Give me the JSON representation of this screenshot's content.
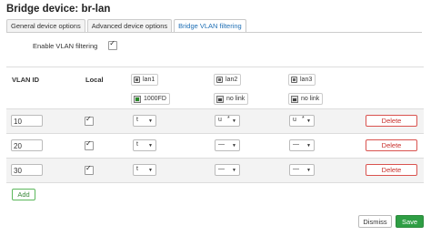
{
  "title": "Bridge device: br-lan",
  "tabs": [
    {
      "label": "General device options",
      "active": false
    },
    {
      "label": "Advanced device options",
      "active": false
    },
    {
      "label": "Bridge VLAN filtering",
      "active": true
    }
  ],
  "vlan_filtering": {
    "label": "Enable VLAN filtering",
    "checked": true
  },
  "table": {
    "headers": {
      "vlan_id": "VLAN ID",
      "local": "Local"
    },
    "ports": [
      {
        "name": "lan1",
        "status": "1000FD",
        "status_icon": "link-up-icon"
      },
      {
        "name": "lan2",
        "status": "no link",
        "status_icon": "no-link-icon"
      },
      {
        "name": "lan3",
        "status": "no link",
        "status_icon": "no-link-icon"
      }
    ],
    "rows": [
      {
        "vlan_id": "10",
        "local": true,
        "lan1": "t",
        "lan2": "u",
        "lan2_flag": "*",
        "lan3": "u",
        "lan3_flag": "*"
      },
      {
        "vlan_id": "20",
        "local": true,
        "lan1": "t",
        "lan2": "—",
        "lan2_flag": "",
        "lan3": "—",
        "lan3_flag": ""
      },
      {
        "vlan_id": "30",
        "local": true,
        "lan1": "t",
        "lan2": "—",
        "lan2_flag": "",
        "lan3": "—",
        "lan3_flag": ""
      }
    ],
    "delete_label": "Delete"
  },
  "add_label": "Add",
  "footer": {
    "dismiss_label": "Dismiss",
    "save_label": "Save"
  },
  "colors": {
    "accent": "#1f6fb5",
    "delete": "#d9534f",
    "add": "#5cb85c",
    "save": "#2e9e44"
  }
}
